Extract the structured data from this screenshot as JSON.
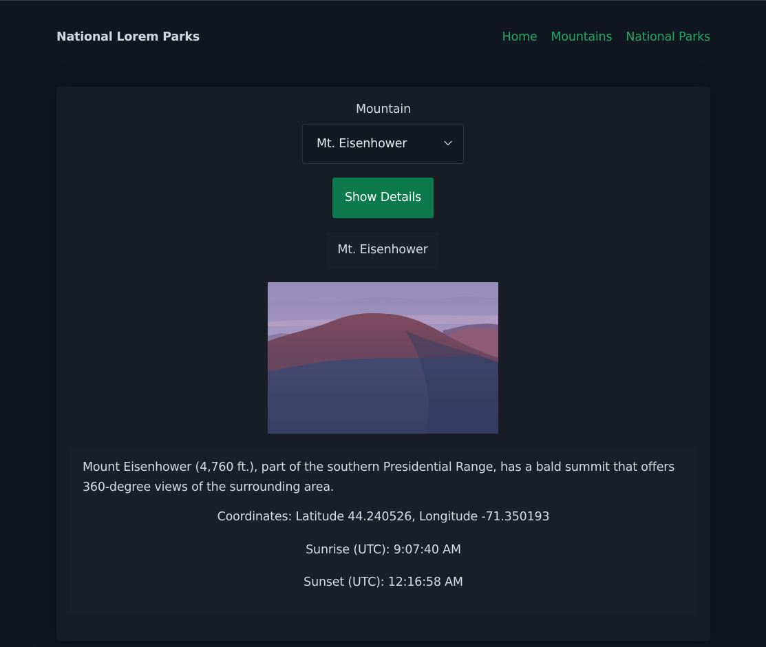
{
  "navbar": {
    "brand": "National Lorem Parks",
    "links": [
      "Home",
      "Mountains",
      "National Parks"
    ]
  },
  "form": {
    "label": "Mountain",
    "selected": "Mt. Eisenhower",
    "button": "Show Details"
  },
  "details": {
    "name": "Mt. Eisenhower",
    "image_alt": "Mt. Eisenhower",
    "description": "Mount Eisenhower (4,760 ft.), part of the southern Presidential Range, has a bald summit that offers 360-degree views of the surrounding area.",
    "coordinates": "Coordinates: Latitude 44.240526, Longitude -71.350193",
    "sunrise": "Sunrise (UTC): 9:07:40 AM",
    "sunset": "Sunset (UTC): 12:16:58 AM"
  },
  "colors": {
    "background": "#111620",
    "card": "#171c25",
    "accent_link": "#1dab62",
    "button": "#0c7a4c"
  },
  "icons": {
    "select_arrow": "chevron-down-icon"
  }
}
